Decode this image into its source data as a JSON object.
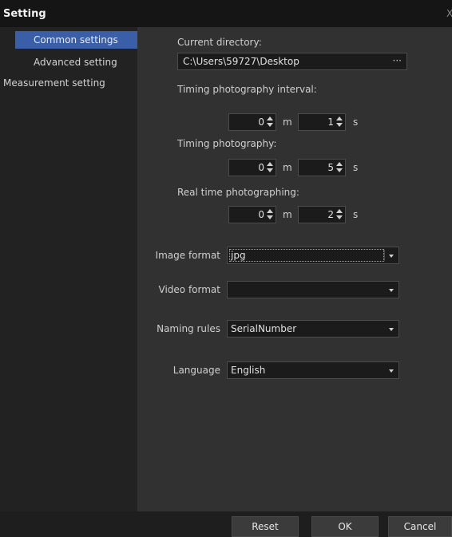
{
  "window": {
    "title": "Setting",
    "close_glyph": "X"
  },
  "sidebar": {
    "items": [
      {
        "label": "Common settings",
        "active": true
      },
      {
        "label": "Advanced setting",
        "active": false
      },
      {
        "label": "Measurement setting",
        "active": false
      }
    ]
  },
  "main": {
    "current_directory": {
      "label": "Current directory:",
      "value": "C:\\Users\\59727\\Desktop",
      "browse_label": "···"
    },
    "timing_interval": {
      "label": "Timing photography interval:",
      "minutes": "0",
      "seconds": "1"
    },
    "timing_photography": {
      "label": "Timing photography:",
      "minutes": "0",
      "seconds": "5"
    },
    "realtime": {
      "label": "Real time photographing:",
      "minutes": "0",
      "seconds": "2"
    },
    "units": {
      "minutes": "m",
      "seconds": "s"
    },
    "image_format": {
      "label": "Image format",
      "value": "jpg"
    },
    "video_format": {
      "label": "Video format",
      "value": ""
    },
    "naming_rules": {
      "label": "Naming rules",
      "value": "SerialNumber"
    },
    "language": {
      "label": "Language",
      "value": "English"
    }
  },
  "footer": {
    "reset_label": "Reset",
    "ok_label": "OK",
    "cancel_label": "Cancel"
  },
  "colors": {
    "accent": "#3a5ea8",
    "background": "#2b2b2b",
    "titlebar": "#151515"
  }
}
